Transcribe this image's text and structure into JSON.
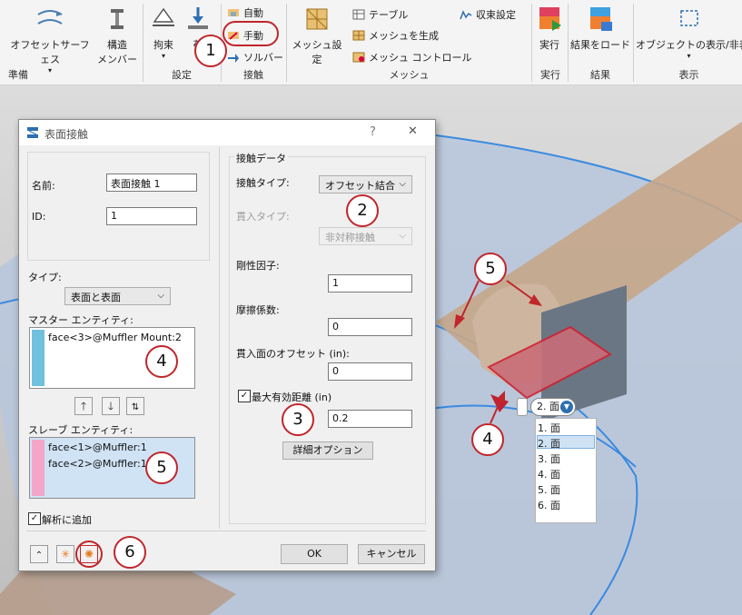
{
  "ribbon": {
    "buttons": {
      "offset_surface": "オフセットサーフェス",
      "structural_member_1": "構造",
      "structural_member_2": "メンバー",
      "constraint": "拘束",
      "load_partial": "荷",
      "contact_auto": "自動",
      "contact_manual": "手動",
      "contact_solver": "ソルバー",
      "mesh_settings": "メッシュ設定",
      "table": "テーブル",
      "generate_mesh": "メッシュを生成",
      "mesh_control": "メッシュ コントロール",
      "convergence_settings": "収束設定",
      "run": "実行",
      "load_results": "結果をロード",
      "object_visibility": "オブジェクトの表示/非表"
    },
    "groups": {
      "prepare": "準備",
      "setup": "設定",
      "contact": "接触",
      "mesh": "メッシュ",
      "run": "実行",
      "results": "結果",
      "display": "表示"
    }
  },
  "dialog": {
    "title": "表面接触",
    "help": "?",
    "close": "✕",
    "name_label": "名前:",
    "name_value": "表面接触 1",
    "id_label": "ID:",
    "id_value": "1",
    "type_label": "タイプ:",
    "type_value": "表面と表面",
    "master_label": "マスター エンティティ:",
    "master_items": [
      "face<3>@Muffler Mount:2"
    ],
    "slave_label": "スレーブ エンティティ:",
    "slave_items": [
      "face<1>@Muffler:1",
      "face<2>@Muffler:1"
    ],
    "add_to_analysis": "解析に追加",
    "contact_data_legend": "接触データ",
    "contact_type_label": "接触タイプ:",
    "contact_type_value": "オフセット結合",
    "penetration_type_label": "貫入タイプ:",
    "penetration_type_value": "非対称接触",
    "stiffness_label": "剛性因子:",
    "stiffness_value": "1",
    "friction_label": "摩擦係数:",
    "friction_value": "0",
    "offset_label": "貫入面のオフセット (in):",
    "offset_value": "0",
    "max_distance_label": "最大有効距離 (in)",
    "max_distance_value": "0.2",
    "advanced_button": "詳細オプション",
    "ok": "OK",
    "cancel": "キャンセル"
  },
  "face_picker": {
    "selected": "2. 面",
    "options": [
      "1. 面",
      "2. 面",
      "3. 面",
      "4. 面",
      "5. 面",
      "6. 面"
    ]
  },
  "callouts": [
    "1",
    "2",
    "3",
    "4",
    "5",
    "6",
    "4",
    "5"
  ],
  "colors": {
    "accent_red": "#c0262b",
    "master_swatch": "#6fc1dd",
    "slave_swatch": "#f3a6c8",
    "selection_blue": "#cfe3f5"
  }
}
